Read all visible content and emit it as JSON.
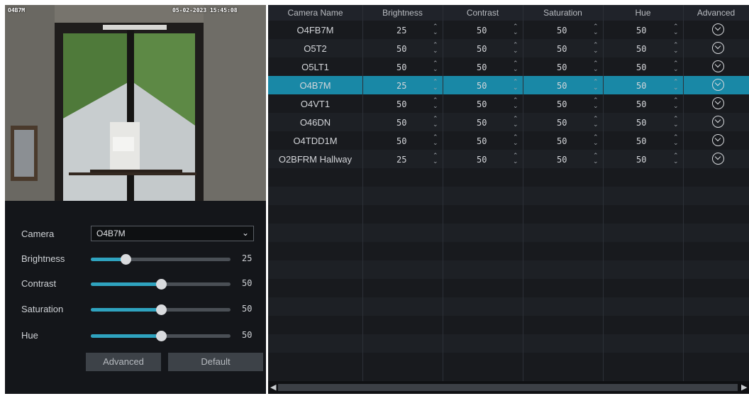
{
  "preview": {
    "camera_osd": "O4B7M",
    "time_osd": "05-02-2023 15:45:08"
  },
  "controls": {
    "camera_label": "Camera",
    "camera_value": "O4B7M",
    "brightness_label": "Brightness",
    "brightness_value": "25",
    "brightness_level": 0.25,
    "contrast_label": "Contrast",
    "contrast_value": "50",
    "contrast_level": 0.5,
    "saturation_label": "Saturation",
    "saturation_value": "50",
    "saturation_level": 0.5,
    "hue_label": "Hue",
    "hue_value": "50",
    "hue_level": 0.5,
    "advanced_label": "Advanced",
    "default_label": "Default"
  },
  "table": {
    "headers": [
      "Camera Name",
      "Brightness",
      "Contrast",
      "Saturation",
      "Hue",
      "Advanced"
    ],
    "selected_row": 3,
    "rows": [
      {
        "name": "O4FB7M",
        "brightness": "25",
        "contrast": "50",
        "saturation": "50",
        "hue": "50"
      },
      {
        "name": "O5T2",
        "brightness": "50",
        "contrast": "50",
        "saturation": "50",
        "hue": "50"
      },
      {
        "name": "O5LT1",
        "brightness": "50",
        "contrast": "50",
        "saturation": "50",
        "hue": "50"
      },
      {
        "name": "O4B7M",
        "brightness": "25",
        "contrast": "50",
        "saturation": "50",
        "hue": "50"
      },
      {
        "name": "O4VT1",
        "brightness": "50",
        "contrast": "50",
        "saturation": "50",
        "hue": "50"
      },
      {
        "name": "O46DN",
        "brightness": "50",
        "contrast": "50",
        "saturation": "50",
        "hue": "50"
      },
      {
        "name": "O4TDD1M",
        "brightness": "50",
        "contrast": "50",
        "saturation": "50",
        "hue": "50"
      },
      {
        "name": "O2BFRM Hallway",
        "brightness": "25",
        "contrast": "50",
        "saturation": "50",
        "hue": "50"
      }
    ]
  },
  "icons": {
    "select": "chevron-down-icon",
    "spinner": "up-down-arrows-icon",
    "advanced": "circle-chevron-down-icon",
    "scroll_left": "scroll-left-arrow-icon",
    "scroll_right": "scroll-right-arrow-icon"
  },
  "colors": {
    "accent": "#2fa3bf",
    "selected_row": "#1988a6",
    "background": "#181a1e"
  }
}
